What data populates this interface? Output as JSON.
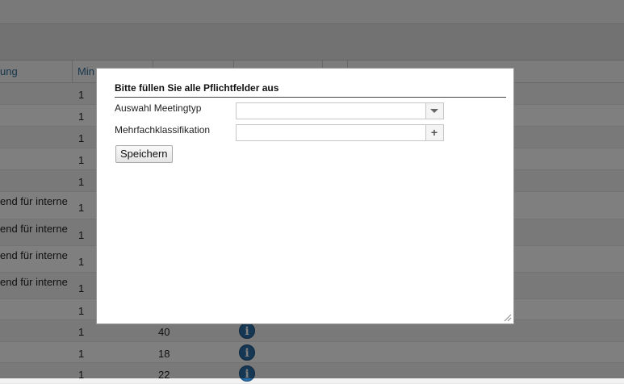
{
  "grid": {
    "columns": [
      "ung",
      "Min",
      "",
      "",
      ""
    ],
    "rows": [
      {
        "desc": "",
        "min": "1",
        "value": "",
        "info": false
      },
      {
        "desc": "",
        "min": "1",
        "value": "",
        "info": false
      },
      {
        "desc": "",
        "min": "1",
        "value": "",
        "info": false
      },
      {
        "desc": "",
        "min": "1",
        "value": "",
        "info": false
      },
      {
        "desc": "",
        "min": "1",
        "value": "",
        "info": false
      },
      {
        "desc": "end für interne",
        "min": "1",
        "value": "",
        "info": false
      },
      {
        "desc": "end für interne",
        "min": "1",
        "value": "",
        "info": false
      },
      {
        "desc": "end für interne",
        "min": "1",
        "value": "",
        "info": false
      },
      {
        "desc": "end für interne",
        "min": "1",
        "value": "",
        "info": false
      },
      {
        "desc": "",
        "min": "1",
        "value": "",
        "info": false
      },
      {
        "desc": "",
        "min": "1",
        "value": "40",
        "info": true
      },
      {
        "desc": "",
        "min": "1",
        "value": "18",
        "info": true
      },
      {
        "desc": "",
        "min": "1",
        "value": "22",
        "info": true
      }
    ]
  },
  "dialog": {
    "title": "Bitte füllen Sie alle Pflichtfelder aus",
    "fields": [
      {
        "label": "Auswahl Meetingtyp",
        "value": ""
      },
      {
        "label": "Mehrfachklassifikation",
        "value": ""
      }
    ],
    "save_label": "Speichern"
  },
  "icons": {
    "info": "info-icon",
    "dropdown": "chevron-down-icon",
    "add": "plus-icon",
    "resize": "resize-grip-icon"
  },
  "colors": {
    "header_text": "#2f6e98",
    "info_icon": "#2a6fa8",
    "overlay": "rgba(0,0,0,0.5)"
  }
}
